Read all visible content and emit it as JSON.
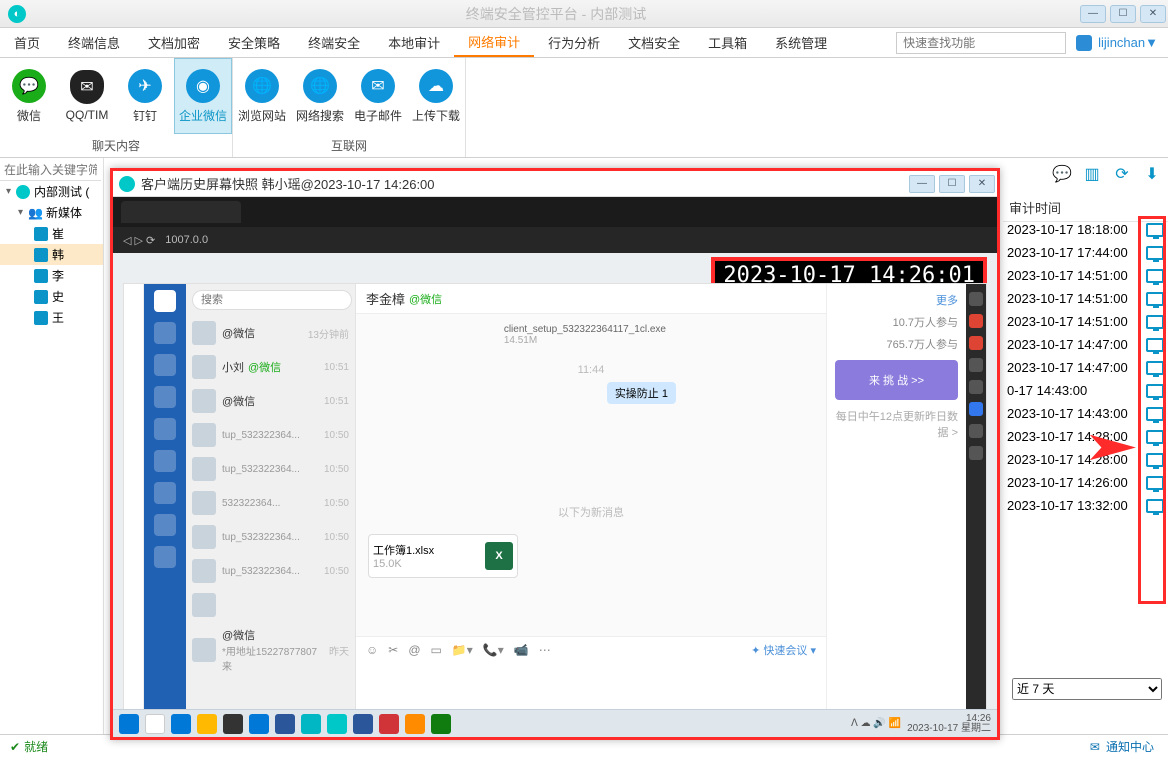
{
  "window": {
    "title": "终端安全管控平台 - 内部测试"
  },
  "user": {
    "name": "lijinchan"
  },
  "search_placeholder": "快速查找功能",
  "menu": {
    "items": [
      "首页",
      "终端信息",
      "文档加密",
      "安全策略",
      "终端安全",
      "本地审计",
      "网络审计",
      "行为分析",
      "文档安全",
      "工具箱",
      "系统管理"
    ],
    "active_index": 6
  },
  "ribbon": {
    "group1_label": "聊天内容",
    "group2_label": "互联网",
    "items1": [
      {
        "label": "微信",
        "color": "#1aad19"
      },
      {
        "label": "QQ/TIM",
        "color": "#ff3b3b",
        "shape": "penguin"
      },
      {
        "label": "钉钉",
        "color": "#1296db"
      },
      {
        "label": "企业微信",
        "color": "#1296db",
        "active": true
      }
    ],
    "items2": [
      {
        "label": "浏览网站",
        "color": "#1296db"
      },
      {
        "label": "网络搜索",
        "color": "#1296db"
      },
      {
        "label": "电子邮件",
        "color": "#1296db"
      },
      {
        "label": "上传下载",
        "color": "#1296db"
      }
    ]
  },
  "sidebar": {
    "filter_placeholder": "在此输入关键字筛",
    "root": "内部测试 (",
    "group": "新媒体",
    "members": [
      "崔",
      "韩",
      "李",
      "史",
      "王"
    ]
  },
  "right": {
    "header": "审计时间",
    "rows": [
      "2023-10-17 18:18:00",
      "2023-10-17 17:44:00",
      "2023-10-17 14:51:00",
      "2023-10-17 14:51:00",
      "2023-10-17 14:51:00",
      "2023-10-17 14:47:00",
      "2023-10-17 14:47:00",
      "0-17 14:43:00",
      "2023-10-17 14:43:00",
      "2023-10-17 14:28:00",
      "2023-10-17 14:28:00",
      "2023-10-17 14:26:00",
      "2023-10-17 13:32:00"
    ],
    "range": "近 7 天"
  },
  "status": {
    "ready": "就绪",
    "notif": "通知中心"
  },
  "popup": {
    "title": "客户端历史屏幕快照 韩小瑶@2023-10-17 14:26:00",
    "timestamp": "2023-10-17 14:26:01",
    "url": "1007.0.0",
    "chat": {
      "search_placeholder": "搜索",
      "header": "李金樟",
      "header_tag": "@微信",
      "time_center": "11:44",
      "divider": "以下为新消息",
      "file": {
        "name": "工作簿1.xlsx",
        "size": "15.0K"
      },
      "file_remote": {
        "name": "client_setup_532322364117_1cl.exe",
        "size": "14.51M"
      },
      "bubble": "实操防止 1",
      "quick": "✦ 快速会议 ▾",
      "side_more": "更多",
      "side_stat1": "10.7万人参与",
      "side_stat2": "765.7万人参与",
      "side_promo": "来 挑 战  >>",
      "side_daily": "每日中午12点更新昨日数据  >",
      "list": [
        {
          "name": "@微信",
          "sub": "",
          "time": "13分钟前"
        },
        {
          "name": "小刘",
          "tag": "@微信",
          "sub": "",
          "time": "10:51"
        },
        {
          "name": "@微信",
          "sub": "",
          "time": "10:51"
        },
        {
          "name": "",
          "sub": "tup_532322364...",
          "time": "10:50"
        },
        {
          "name": "",
          "sub": "tup_532322364...",
          "time": "10:50"
        },
        {
          "name": "",
          "sub": "532322364...",
          "time": "10:50"
        },
        {
          "name": "",
          "sub": "tup_532322364...",
          "time": "10:50"
        },
        {
          "name": "",
          "sub": "tup_532322364...",
          "time": "10:50"
        },
        {
          "name": "",
          "sub": "",
          "time": ""
        },
        {
          "name": "@微信",
          "sub": "*用地址15227877807来",
          "time": "昨天"
        }
      ],
      "taskbar_time": "14:26",
      "taskbar_date": "2023-10-17 星期二"
    }
  }
}
